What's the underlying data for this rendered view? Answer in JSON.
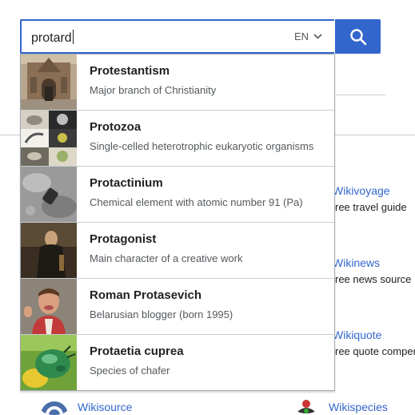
{
  "search": {
    "query": "protard",
    "lang": "EN"
  },
  "suggestions": [
    {
      "title": "Protestantism",
      "desc": "Major branch of Christianity",
      "thumb": "church-facade"
    },
    {
      "title": "Protozoa",
      "desc": "Single-celled heterotrophic eukaryotic organisms",
      "thumb": "microorganisms"
    },
    {
      "title": "Protactinium",
      "desc": "Chemical element with atomic number 91 (Pa)",
      "thumb": "micrograph"
    },
    {
      "title": "Protagonist",
      "desc": "Main character of a creative work",
      "thumb": "painting"
    },
    {
      "title": "Roman Protasevich",
      "desc": "Belarusian blogger (born 1995)",
      "thumb": "portrait"
    },
    {
      "title": "Protaetia cuprea",
      "desc": "Species of chafer",
      "thumb": "green-beetle"
    }
  ],
  "background": {
    "wikivoyage": {
      "name": "Wikivoyage",
      "desc": "ree travel guide"
    },
    "wikinews": {
      "name": "Wikinews",
      "desc": "ree news source"
    },
    "wikiquote": {
      "name": "Wikiquote",
      "desc": "ree quote compen"
    },
    "wikisource": {
      "name": "Wikisource"
    },
    "wikispecies": {
      "name": "Wikispecies"
    }
  },
  "colors": {
    "accent": "#3366cc",
    "link": "#3366cc",
    "border": "#a2a9b1"
  }
}
